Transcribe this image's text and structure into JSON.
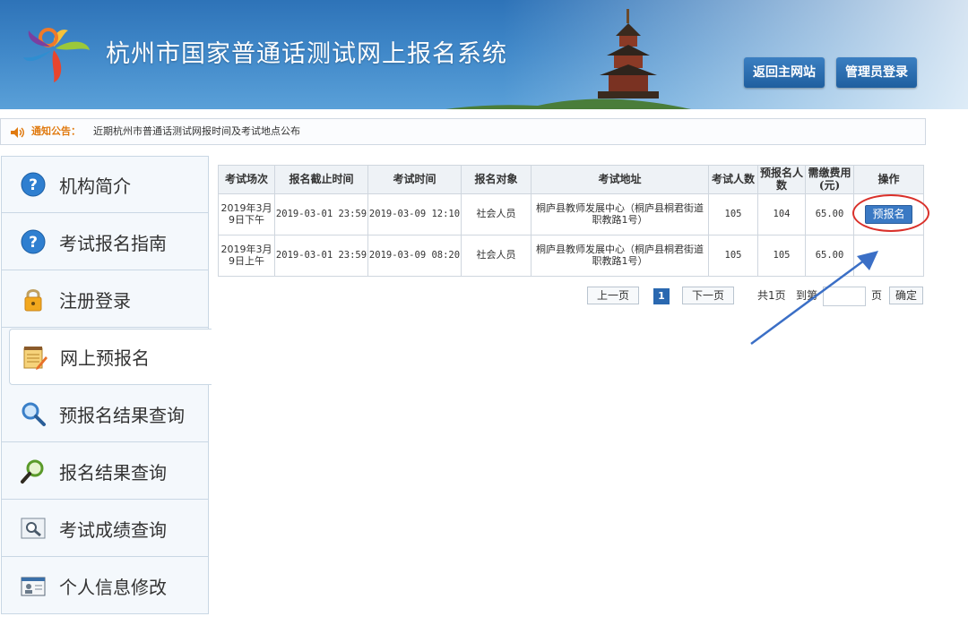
{
  "header": {
    "title": "杭州市国家普通话测试网上报名系统",
    "home_button": "返回主网站",
    "admin_button": "管理员登录"
  },
  "notice": {
    "label": "通知公告：",
    "text": "近期杭州市普通话测试网报时间及考试地点公布"
  },
  "sidebar": {
    "items": [
      {
        "label": "机构简介",
        "icon": "question-icon"
      },
      {
        "label": "考试报名指南",
        "icon": "question-icon"
      },
      {
        "label": "注册登录",
        "icon": "lock-icon"
      },
      {
        "label": "网上预报名",
        "icon": "notepad-icon"
      },
      {
        "label": "预报名结果查询",
        "icon": "magnifier-icon"
      },
      {
        "label": "报名结果查询",
        "icon": "green-magnifier-icon"
      },
      {
        "label": "考试成绩查询",
        "icon": "search-window-icon"
      },
      {
        "label": "个人信息修改",
        "icon": "id-card-icon"
      }
    ]
  },
  "table": {
    "headers": [
      "考试场次",
      "报名截止时间",
      "考试时间",
      "报名对象",
      "考试地址",
      "考试人数",
      "预报名人数",
      "需缴费用(元)",
      "操作"
    ],
    "rows": [
      {
        "session": "2019年3月9日下午",
        "deadline": "2019-03-01 23:59",
        "exam_time": "2019-03-09 12:10",
        "target": "社会人员",
        "address": "桐庐县教师发展中心（桐庐县桐君街道职教路1号）",
        "capacity": "105",
        "pre_count": "104",
        "fee": "65.00",
        "action": "预报名"
      },
      {
        "session": "2019年3月9日上午",
        "deadline": "2019-03-01 23:59",
        "exam_time": "2019-03-09 08:20",
        "target": "社会人员",
        "address": "桐庐县教师发展中心（桐庐县桐君街道职教路1号）",
        "capacity": "105",
        "pre_count": "105",
        "fee": "65.00",
        "action": ""
      }
    ]
  },
  "pager": {
    "prev": "上一页",
    "current": "1",
    "next": "下一页",
    "total": "共1页",
    "goto": "到第",
    "page_unit": "页",
    "confirm": "确定"
  },
  "colors": {
    "header_blue": "#2e73b8",
    "button_blue": "#3a79c4",
    "highlight_red": "#d9302a",
    "arrow_blue": "#3b6fc6"
  }
}
